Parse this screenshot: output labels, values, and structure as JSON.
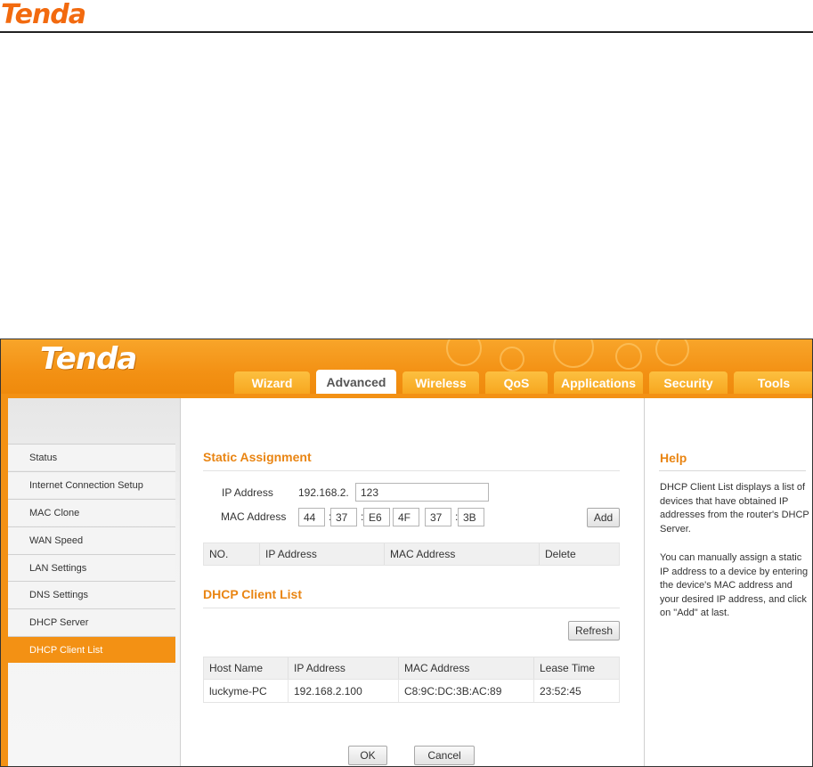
{
  "document": {
    "logo_text": "Tenda"
  },
  "app": {
    "logo_text": "Tenda",
    "tabs": [
      {
        "label": "Wizard",
        "active": false
      },
      {
        "label": "Advanced",
        "active": true
      },
      {
        "label": "Wireless",
        "active": false
      },
      {
        "label": "QoS",
        "active": false
      },
      {
        "label": "Applications",
        "active": false
      },
      {
        "label": "Security",
        "active": false
      },
      {
        "label": "Tools",
        "active": false
      }
    ]
  },
  "sidebar": {
    "items": [
      {
        "label": "Status",
        "active": false
      },
      {
        "label": "Internet Connection Setup",
        "active": false
      },
      {
        "label": "MAC Clone",
        "active": false
      },
      {
        "label": "WAN Speed",
        "active": false
      },
      {
        "label": "LAN Settings",
        "active": false
      },
      {
        "label": "DNS Settings",
        "active": false
      },
      {
        "label": "DHCP Server",
        "active": false
      },
      {
        "label": "DHCP Client List",
        "active": true
      }
    ]
  },
  "static_assignment": {
    "title": "Static Assignment",
    "ip_label": "IP Address",
    "ip_prefix": "192.168.2.",
    "ip_value": "123",
    "mac_label": "MAC Address",
    "mac_values": [
      "44",
      "37",
      "E6",
      "4F",
      "37",
      "3B"
    ],
    "mac_separator": ":",
    "add_label": "Add",
    "table_headers": [
      "NO.",
      "IP Address",
      "MAC Address",
      "Delete"
    ]
  },
  "client_list": {
    "title": "DHCP Client List",
    "refresh_label": "Refresh",
    "headers": [
      "Host Name",
      "IP Address",
      "MAC Address",
      "Lease Time"
    ],
    "rows": [
      {
        "host": "luckyme-PC",
        "ip": "192.168.2.100",
        "mac": "C8:9C:DC:3B:AC:89",
        "lease": "23:52:45"
      }
    ]
  },
  "actions": {
    "ok_label": "OK",
    "cancel_label": "Cancel"
  },
  "help": {
    "title": "Help",
    "paragraphs": [
      "DHCP Client List displays a list of devices that have obtained IP addresses from the router's DHCP Server.",
      "You can manually assign a static IP address to a device by entering the device's MAC address and your desired IP address, and click on \"Add\" at last."
    ]
  },
  "colors": {
    "accent": "#f39114",
    "title_orange": "#e98513"
  }
}
